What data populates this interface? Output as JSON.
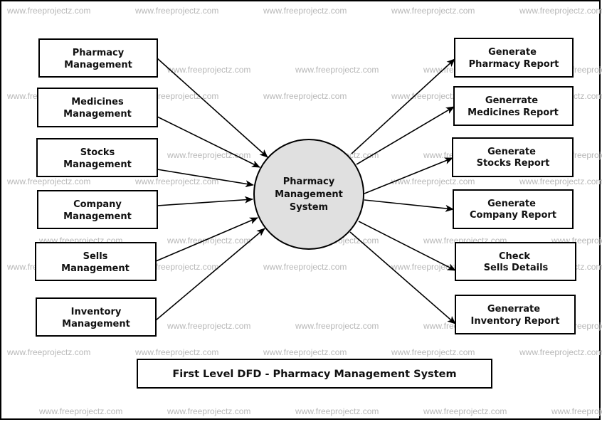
{
  "diagram": {
    "type": "Data Flow Diagram (Level 1)",
    "title": "First Level DFD - Pharmacy Management System",
    "watermark": "www.freeprojectz.com",
    "colors": {
      "process_fill": "#e0e0e0",
      "stroke": "#000000",
      "watermark": "#b8b8b8",
      "background": "#ffffff"
    },
    "process": {
      "id": "pms",
      "lines": [
        "Pharmacy",
        "Management",
        "System"
      ]
    },
    "inputs": [
      {
        "id": "in-pharmacy",
        "lines": [
          "Pharmacy",
          "Management"
        ]
      },
      {
        "id": "in-medicines",
        "lines": [
          "Medicines",
          "Management"
        ]
      },
      {
        "id": "in-stocks",
        "lines": [
          "Stocks",
          "Management"
        ]
      },
      {
        "id": "in-company",
        "lines": [
          "Company",
          "Management"
        ]
      },
      {
        "id": "in-sells",
        "lines": [
          "Sells",
          "Management"
        ]
      },
      {
        "id": "in-inventory",
        "lines": [
          "Inventory",
          "Management"
        ]
      }
    ],
    "outputs": [
      {
        "id": "out-pharmacy",
        "lines": [
          "Generate",
          "Pharmacy Report"
        ]
      },
      {
        "id": "out-medicines",
        "lines": [
          "Generrate",
          "Medicines Report"
        ]
      },
      {
        "id": "out-stocks",
        "lines": [
          "Generate",
          "Stocks Report"
        ]
      },
      {
        "id": "out-company",
        "lines": [
          "Generate",
          "Company Report"
        ]
      },
      {
        "id": "out-sells",
        "lines": [
          "Check",
          "Sells Details"
        ]
      },
      {
        "id": "out-inventory",
        "lines": [
          "Generrate",
          "Inventory Report"
        ]
      }
    ],
    "flows": [
      {
        "from": "in-pharmacy",
        "to": "pms"
      },
      {
        "from": "in-medicines",
        "to": "pms"
      },
      {
        "from": "in-stocks",
        "to": "pms"
      },
      {
        "from": "in-company",
        "to": "pms"
      },
      {
        "from": "in-sells",
        "to": "pms"
      },
      {
        "from": "in-inventory",
        "to": "pms"
      },
      {
        "from": "pms",
        "to": "out-pharmacy"
      },
      {
        "from": "pms",
        "to": "out-medicines"
      },
      {
        "from": "pms",
        "to": "out-stocks"
      },
      {
        "from": "pms",
        "to": "out-company"
      },
      {
        "from": "pms",
        "to": "out-sells"
      },
      {
        "from": "pms",
        "to": "out-inventory"
      }
    ]
  }
}
